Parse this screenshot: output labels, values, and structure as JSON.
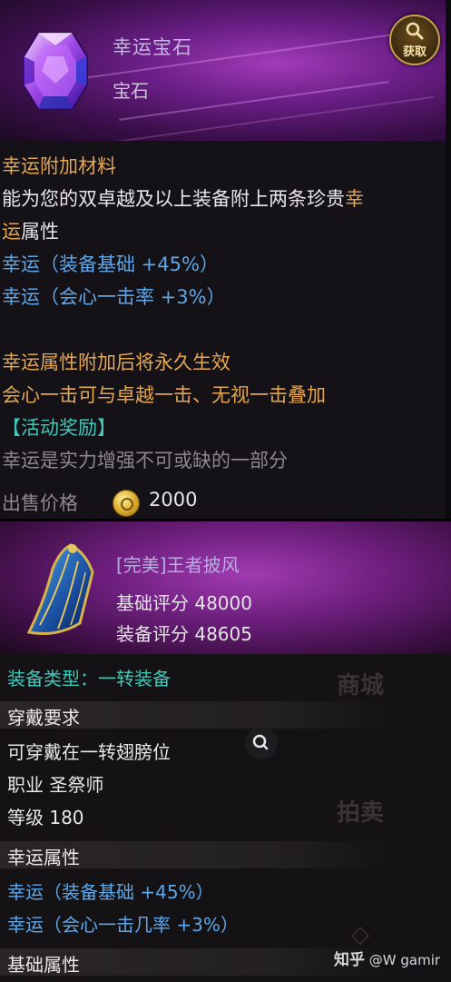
{
  "item1": {
    "name": "幸运宝石",
    "type": "宝石",
    "acquire_label": "获取",
    "section_title": "幸运附加材料",
    "desc_line1_a": "能为您的双卓越及以上装备附上两条珍贵",
    "desc_line1_b": "幸",
    "desc_line2_a": "运",
    "desc_line2_b": "属性",
    "luck_stat1": "幸运（装备基础 +45%）",
    "luck_stat2": "幸运（会心一击率 +3%）",
    "note1": "幸运属性附加后将永久生效",
    "note2": "会心一击可与卓越一击、无视一击叠加",
    "event_tag": "【活动奖励】",
    "flavor": "幸运是实力增强不可或缺的一部分",
    "sell_label": "出售价格",
    "sell_price": "2000"
  },
  "item2": {
    "name": "[完美]王者披风",
    "base_score_label": "基础评分",
    "base_score": "48000",
    "equip_score_label": "装备评分",
    "equip_score": "48605",
    "equip_type": "装备类型：一转装备",
    "req_title": "穿戴要求",
    "req_slot": "可穿戴在一转翅膀位",
    "req_class": "职业 圣祭师",
    "req_level": "等级 180",
    "luck_title": "幸运属性",
    "luck_stat1": "幸运（装备基础 +45%）",
    "luck_stat2": "幸运（会心一击几率 +3%）",
    "base_title": "基础属性"
  },
  "watermark": {
    "site": "知乎",
    "user": "@W gamir"
  },
  "colors": {
    "orange": "#e4a652",
    "blue": "#5fa6e8",
    "teal": "#41c7b8",
    "purple": "#6a1e86"
  },
  "icons": [
    "luck-gem-icon",
    "acquire-magnifier-icon",
    "gold-coin-icon",
    "royal-cape-icon",
    "search-icon"
  ]
}
